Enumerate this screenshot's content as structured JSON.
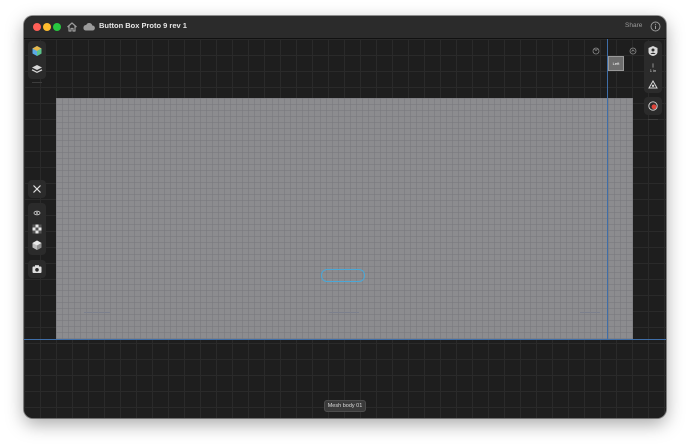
{
  "titlebar": {
    "title": "Button Box Proto 9 rev 1",
    "share_label": "Share"
  },
  "icons": {
    "home": "home-icon",
    "cloud": "cloud-icon",
    "info": "info-icon",
    "appearance": "appearance-icon",
    "layers": "layers-icon",
    "close": "close-icon",
    "visibility": "eye-icon",
    "checker": "checkerboard-icon",
    "cube": "cube-icon",
    "camera": "camera-icon",
    "user_shield": "profile-icon",
    "snap": "snap-icon",
    "measure": "measure-icon",
    "record": "record-icon"
  },
  "view_cube": {
    "face_label": "Left"
  },
  "right_toolbar": {
    "unit_label": "1 in"
  },
  "status": {
    "selection_label": "Mesh body 01"
  },
  "colors": {
    "window_bg": "#1a1a1a",
    "titlebar_bg": "#2b2b2b",
    "plane_fill": "#8c8c8f",
    "axis_blue": "#3f6ea8",
    "selection_cyan": "#4aa7d6",
    "record_red": "#e0463c"
  }
}
